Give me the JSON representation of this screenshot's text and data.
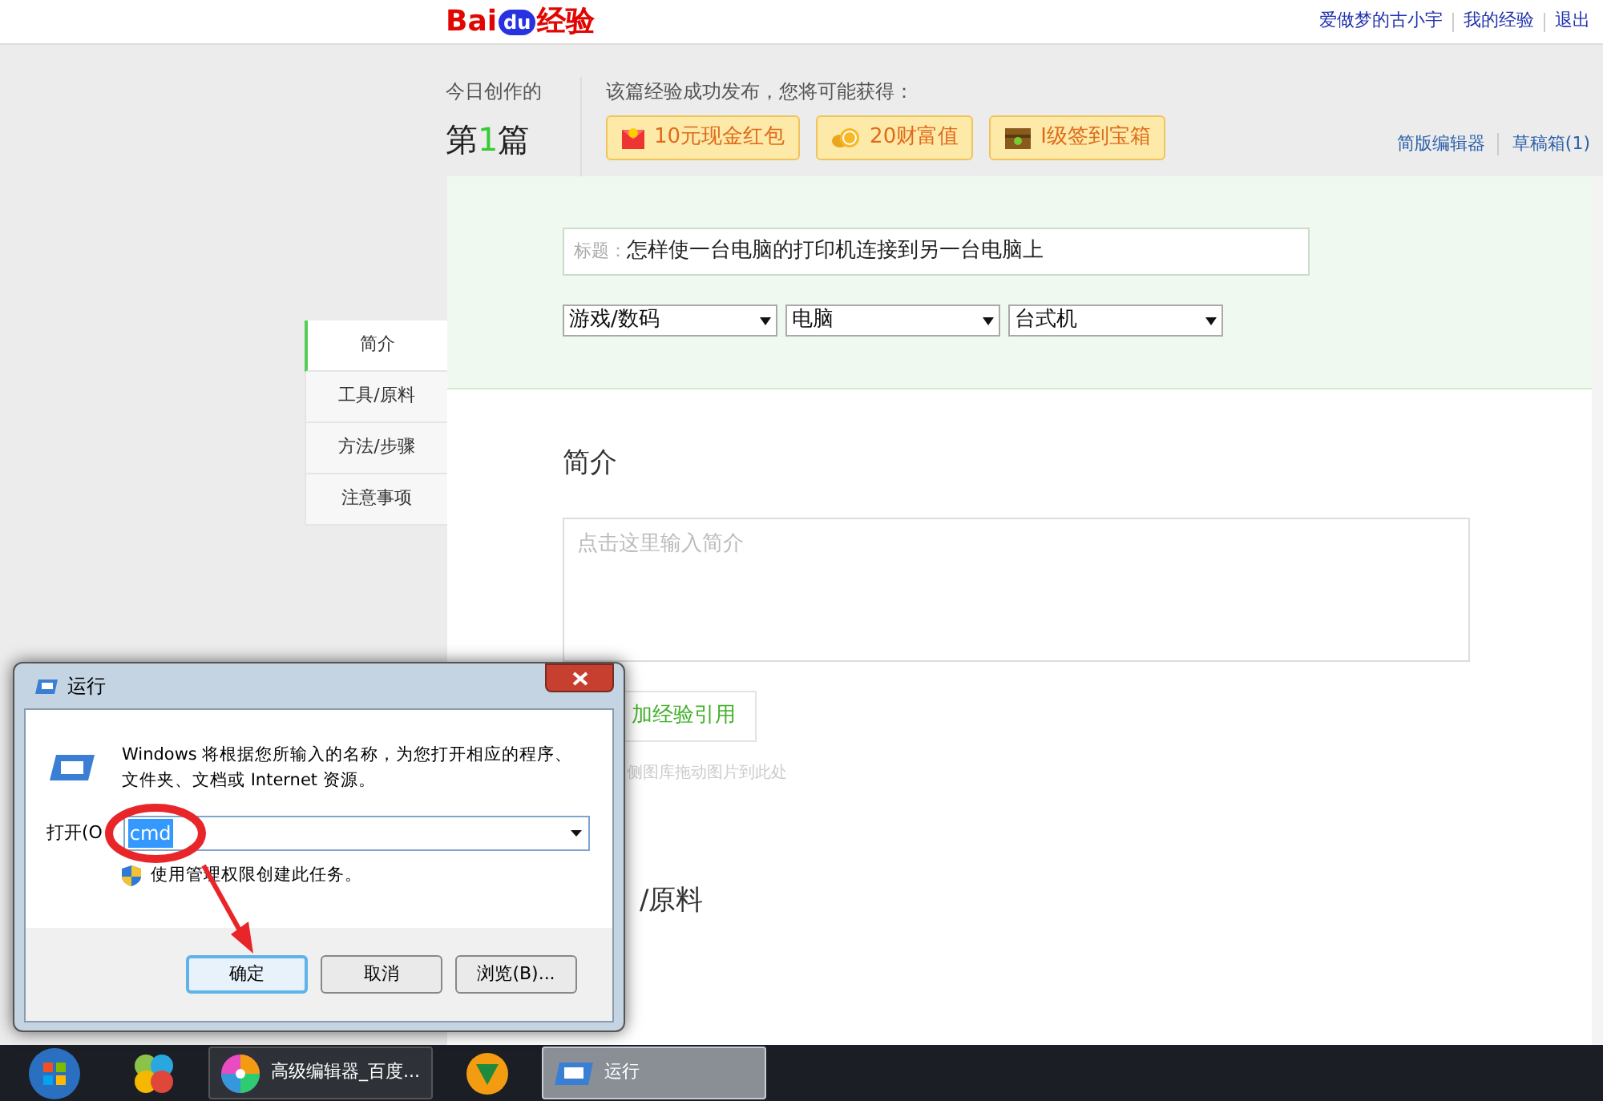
{
  "header": {
    "logo": {
      "left": "Bai",
      "badge": "du",
      "right": "经验"
    },
    "user_links": [
      "爱做梦的古小宇",
      "我的经验",
      "退出"
    ]
  },
  "today": {
    "label": "今日创作的",
    "count_parts": [
      "第",
      "1",
      "篇"
    ]
  },
  "rewards": {
    "heading": "该篇经验成功发布，您将可能获得：",
    "items": [
      {
        "kind": "envelope",
        "label": "10元现金红包"
      },
      {
        "kind": "coins",
        "label": "20财富值"
      },
      {
        "kind": "chest",
        "label": "I级签到宝箱"
      }
    ]
  },
  "editor_links": [
    "简版编辑器",
    "草稿箱(1)"
  ],
  "form": {
    "title_label": "标题：",
    "title_value": "怎样使一台电脑的打印机连接到另一台电脑上",
    "categories": [
      "游戏/数码",
      "电脑",
      "台式机"
    ]
  },
  "nav": [
    {
      "label": "简介",
      "selected": true
    },
    {
      "label": "工具/原料",
      "selected": false
    },
    {
      "label": "方法/步骤",
      "selected": false
    },
    {
      "label": "注意事项",
      "selected": false
    }
  ],
  "intro": {
    "heading": "简介",
    "placeholder": "点击这里输入简介",
    "cite_button": "加经验引用",
    "drop_hint": "侧图库拖动图片到此处"
  },
  "tools_heading": "/原料",
  "dialog": {
    "title": "运行",
    "message": "Windows 将根据您所输入的名称，为您打开相应的程序、文件夹、文档或 Internet 资源。",
    "open_label": "打开(O",
    "value": "cmd",
    "admin_note": "使用管理权限创建此任务。",
    "buttons": [
      {
        "label": "确定",
        "selected": true
      },
      {
        "label": "取消",
        "selected": false
      },
      {
        "label": "浏览(B)...",
        "selected": false
      }
    ]
  },
  "taskbar": [
    {
      "kind": "start"
    },
    {
      "kind": "pinwheel"
    },
    {
      "kind": "browser",
      "label": "高级编辑器_百度...",
      "selected": false
    },
    {
      "kind": "player"
    },
    {
      "kind": "run",
      "label": "运行",
      "selected": true
    }
  ]
}
